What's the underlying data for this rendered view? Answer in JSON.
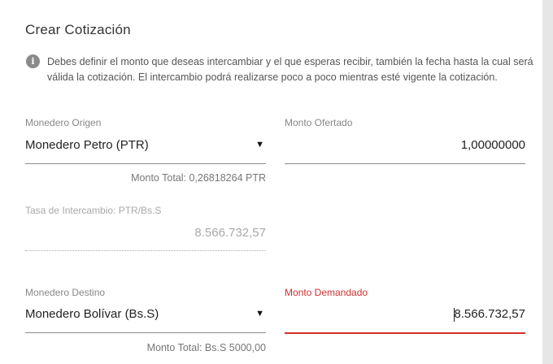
{
  "title": "Crear Cotización",
  "info": {
    "icon": "info-icon",
    "text": "Debes definir el monto que deseas intercambiar y el que esperas recibir, también la fecha hasta la cual será válida la cotización. El intercambio podrá realizarse poco a poco mientras esté vigente la cotización."
  },
  "origin_wallet": {
    "label": "Monedero Origen",
    "value": "Monedero Petro (PTR)",
    "arrow": "▼",
    "total": "Monto Total: 0,26818264 PTR"
  },
  "offered_amount": {
    "label": "Monto Ofertado",
    "value": "1,00000000"
  },
  "exchange_rate": {
    "label": "Tasa de Intercambio: PTR/Bs.S",
    "value": "8.566.732,57"
  },
  "destination_wallet": {
    "label": "Monedero Destino",
    "value": "Monedero Bolívar (Bs.S)",
    "arrow": "▼",
    "total": "Monto Total: Bs.S 5000,00"
  },
  "demanded_amount": {
    "label": "Monto Demandado",
    "value": "8.566.732,57"
  },
  "colors": {
    "accent": "#d32f2f",
    "background": "#e6e6e6",
    "card": "#ffffff"
  }
}
